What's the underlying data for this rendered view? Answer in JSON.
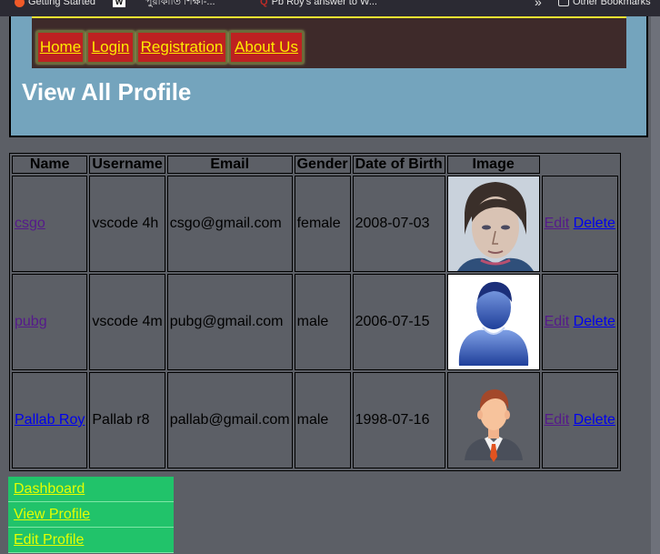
{
  "bookmarks": {
    "items": [
      "Getting Started",
      "W",
      "পুরাকীর্তি শিক্ষা-...",
      "Pb Roy's answer to W..."
    ],
    "more": "»",
    "other": "Other Bookmarks"
  },
  "nav": {
    "items": [
      "Home",
      "Login",
      "Registration",
      "About Us"
    ]
  },
  "page_title": "View All Profile",
  "table": {
    "headers": [
      "Name",
      "Username",
      "Email",
      "Gender",
      "Date of Birth",
      "Image"
    ],
    "rows": [
      {
        "name": "csgo",
        "username": "vscode 4h",
        "email": "csgo@gmail.com",
        "gender": "female",
        "dob": "2008-07-03",
        "image": "portrait-sketch",
        "edit": "Edit",
        "delete": "Delete"
      },
      {
        "name": "pubg",
        "username": "vscode 4m",
        "email": "pubg@gmail.com",
        "gender": "male",
        "dob": "2006-07-15",
        "image": "blue-user-avatar",
        "edit": "Edit",
        "delete": "Delete"
      },
      {
        "name": "Pallab Roy",
        "username": "Pallab r8",
        "email": "pallab@gmail.com",
        "gender": "male",
        "dob": "1998-07-16",
        "image": "businessman-avatar",
        "edit": "Edit",
        "delete": "Delete"
      }
    ]
  },
  "sidebar": {
    "items": [
      "Dashboard",
      "View Profile",
      "Edit Profile"
    ]
  },
  "colors": {
    "page_bg": "#5c5f66",
    "header_bg": "#74a4bd",
    "nav_bg": "#3e2a2a",
    "nav_button": "#bd2121",
    "nav_text": "#ffeb00",
    "sidebar_bg": "#21c36a",
    "sidebar_text": "#e4ff00"
  }
}
